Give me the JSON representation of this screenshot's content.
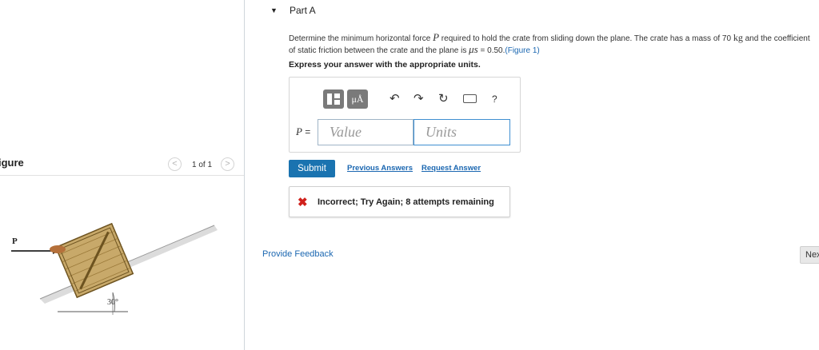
{
  "figure_panel": {
    "title": "igure",
    "pager_text": "1 of 1",
    "prev_symbol": "<",
    "next_symbol": ">",
    "figure_labels": {
      "force": "P",
      "angle": "30°"
    }
  },
  "part": {
    "toggle_symbol": "▼",
    "title": "Part A"
  },
  "problem": {
    "text_1": "Determine the minimum horizontal force ",
    "var_P": "P",
    "text_2": " required to hold the crate from sliding down the plane. The crate has a mass of 70 ",
    "unit_kg": "kg",
    "text_3": " and the coefficient of static friction between the crate and the plane is ",
    "var_mu": "μs",
    "text_4": " = 0.50.",
    "figure_link": "(Figure 1)"
  },
  "instruction": "Express your answer with the appropriate units.",
  "toolbar": {
    "mu_label": "μÅ",
    "undo_icon": "↶",
    "redo_icon": "↷",
    "reset_icon": "↻",
    "help_label": "?"
  },
  "answer": {
    "var_label": "P",
    "equals": " =",
    "value_placeholder": "Value",
    "units_placeholder": "Units"
  },
  "actions": {
    "submit_label": "Submit",
    "previous_answers_label": "Previous Answers",
    "request_answer_label": "Request Answer"
  },
  "feedback": {
    "icon": "✖",
    "message": "Incorrect; Try Again; 8 attempts remaining"
  },
  "provide_feedback_label": "Provide Feedback",
  "next_label": "Nex",
  "colors": {
    "link": "#1b67b1",
    "submit_bg": "#1a73b0",
    "error": "#d0211c",
    "crate": "#c8a96a"
  }
}
